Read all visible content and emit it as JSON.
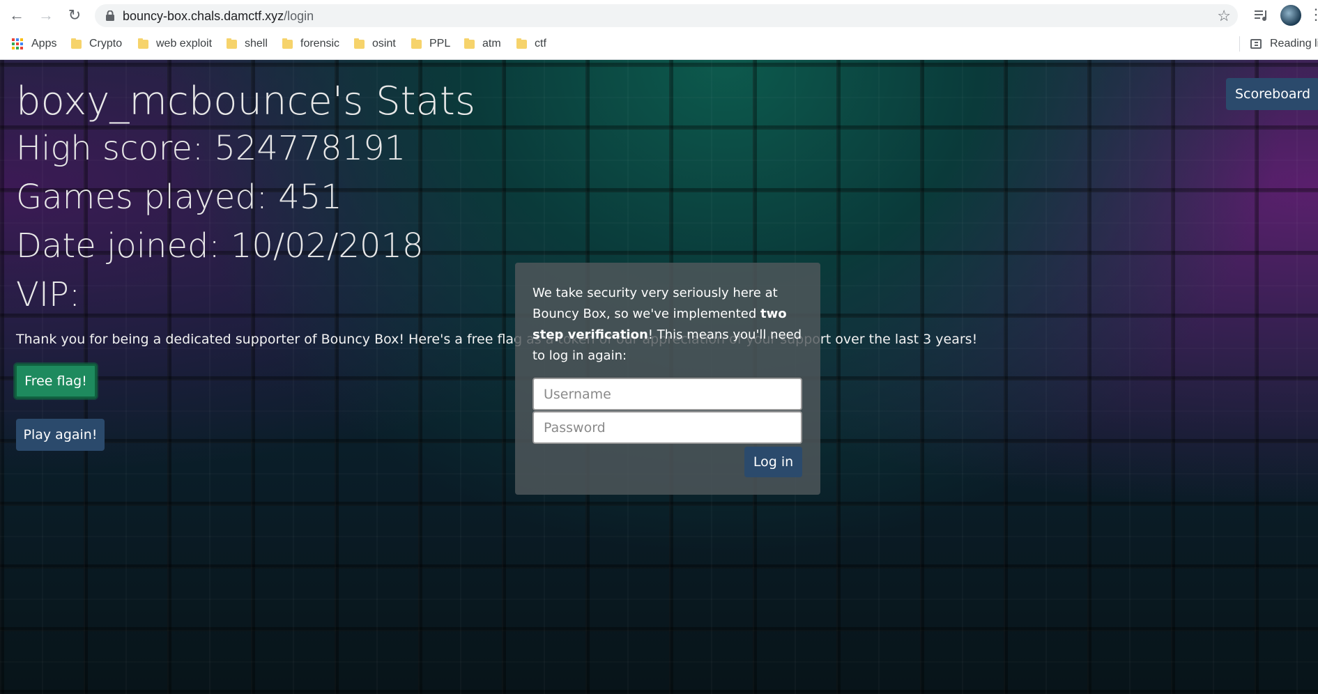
{
  "browser": {
    "url_host": "bouncy-box.chals.damctf.xyz",
    "url_path": "/login",
    "bookmarks": [
      "Apps",
      "Crypto",
      "web exploit",
      "shell",
      "forensic",
      "osint",
      "PPL",
      "atm",
      "ctf"
    ],
    "reading_list": "Reading lis"
  },
  "stats": {
    "title": "boxy_mcbounce's Stats",
    "high_score": "High score: 524778191",
    "games_played": "Games played: 451",
    "date_joined": "Date joined: 10/02/2018",
    "vip": "VIP:"
  },
  "thanks_text": "Thank you for being a dedicated supporter of Bouncy Box! Here's a free flag as a token of our appreciation of your support over the last 3 years!",
  "buttons": {
    "free_flag": "Free flag!",
    "play_again": "Play again!",
    "scoreboard": "Scoreboard"
  },
  "modal": {
    "text_1": "We take security very seriously here at Bouncy Box, so we've implemented ",
    "text_bold": "two step verification",
    "text_2": "! This means you'll need to log in again:",
    "username_placeholder": "Username",
    "password_placeholder": "Password",
    "login_label": "Log in"
  }
}
